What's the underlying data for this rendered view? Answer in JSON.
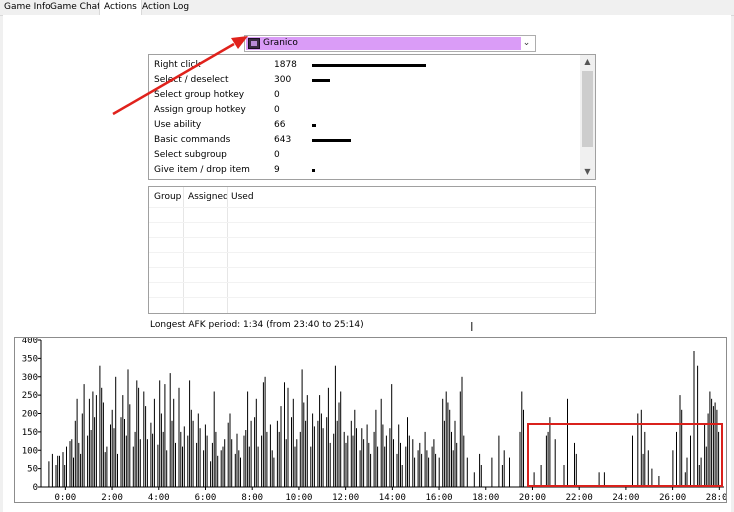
{
  "tabs": [
    {
      "label": "Game Info"
    },
    {
      "label": "Game Chat"
    },
    {
      "label": "Actions",
      "active": true
    },
    {
      "label": "Action Log"
    }
  ],
  "player_select": {
    "selected": "Granico",
    "icon": "hero-portrait-icon",
    "highlight_color": "#da9cf7"
  },
  "actions": [
    {
      "name": "Right click",
      "count": "1878",
      "fraction": 1.0
    },
    {
      "name": "Select / deselect",
      "count": "300",
      "fraction": 0.16
    },
    {
      "name": "Select group hotkey",
      "count": "0",
      "fraction": 0
    },
    {
      "name": "Assign group hotkey",
      "count": "0",
      "fraction": 0
    },
    {
      "name": "Use ability",
      "count": "66",
      "fraction": 0.035
    },
    {
      "name": "Basic commands",
      "count": "643",
      "fraction": 0.34
    },
    {
      "name": "Select subgroup",
      "count": "0",
      "fraction": 0
    },
    {
      "name": "Give item / drop item",
      "count": "9",
      "fraction": 0.005
    }
  ],
  "hotkey_table": {
    "columns": [
      "Group",
      "Assigned",
      "Used"
    ]
  },
  "afk_text": "Longest AFK period: 1:34 (from 23:40 to 25:14)",
  "annotation_colors": {
    "arrow": "#e0221c",
    "box": "#d9211c"
  },
  "chart_data": {
    "type": "bar",
    "ylim": [
      0,
      400
    ],
    "yticks": [
      "0",
      "50",
      "100",
      "150",
      "200",
      "250",
      "300",
      "350",
      "400"
    ],
    "xticks": [
      "0:00",
      "2:00",
      "4:00",
      "6:00",
      "8:00",
      "10:00",
      "12:00",
      "14:00",
      "16:00",
      "18:00",
      "20:00",
      "22:00",
      "24:00",
      "26:00",
      "28:00"
    ],
    "x_unit_minutes_per_bar": 0.1667,
    "xlim_minutes": [
      0,
      29.2
    ],
    "values": [
      0,
      70,
      0,
      90,
      0,
      60,
      85,
      85,
      0,
      95,
      60,
      110,
      0,
      125,
      130,
      80,
      180,
      240,
      120,
      90,
      200,
      280,
      0,
      140,
      240,
      155,
      260,
      190,
      250,
      0,
      330,
      270,
      230,
      95,
      110,
      0,
      170,
      210,
      160,
      300,
      90,
      0,
      190,
      250,
      185,
      140,
      320,
      225,
      0,
      110,
      150,
      290,
      270,
      130,
      0,
      260,
      220,
      130,
      0,
      175,
      145,
      240,
      0,
      115,
      290,
      200,
      150,
      280,
      100,
      0,
      310,
      180,
      240,
      120,
      0,
      270,
      150,
      110,
      165,
      0,
      140,
      290,
      210,
      180,
      0,
      120,
      200,
      160,
      0,
      100,
      170,
      140,
      0,
      70,
      120,
      260,
      150,
      85,
      0,
      100,
      110,
      130,
      0,
      175,
      200,
      130,
      0,
      90,
      145,
      100,
      80,
      0,
      140,
      155,
      260,
      110,
      180,
      0,
      190,
      240,
      110,
      0,
      140,
      285,
      300,
      150,
      0,
      170,
      100,
      80,
      0,
      180,
      150,
      220,
      0,
      285,
      130,
      270,
      0,
      190,
      240,
      110,
      130,
      0,
      150,
      320,
      230,
      180,
      250,
      0,
      110,
      200,
      165,
      0,
      180,
      250,
      200,
      160,
      0,
      190,
      270,
      120,
      0,
      145,
      330,
      180,
      230,
      260,
      0,
      150,
      120,
      140,
      0,
      180,
      140,
      210,
      160,
      0,
      100,
      160,
      130,
      0,
      170,
      120,
      90,
      0,
      150,
      210,
      110,
      0,
      240,
      170,
      110,
      140,
      0,
      160,
      280,
      130,
      0,
      90,
      170,
      120,
      60,
      0,
      110,
      190,
      140,
      0,
      130,
      80,
      0,
      100,
      120,
      90,
      0,
      150,
      100,
      80,
      0,
      110,
      130,
      90,
      0,
      80,
      0,
      240,
      180,
      260,
      230,
      210,
      150,
      100,
      180,
      120,
      0,
      260,
      300,
      140,
      0,
      80,
      0,
      0,
      0,
      40,
      0,
      0,
      90,
      60,
      0,
      0,
      0,
      0,
      0,
      80,
      0,
      0,
      0,
      140,
      0,
      60,
      100,
      0,
      0,
      80,
      0,
      0,
      0,
      0,
      0,
      150,
      260,
      210,
      0,
      0,
      0,
      0,
      0,
      40,
      0,
      0,
      0,
      60,
      0,
      0,
      140,
      150,
      190,
      0,
      0,
      130,
      0,
      0,
      0,
      0,
      60,
      0,
      240,
      0,
      0,
      0,
      120,
      90,
      0,
      0,
      0,
      0,
      0,
      0,
      0,
      0,
      0,
      0,
      0,
      0,
      40,
      0,
      0,
      40,
      0,
      0,
      0,
      0,
      0,
      0,
      0,
      0,
      0,
      0,
      0,
      0,
      0,
      0,
      0,
      140,
      0,
      0,
      200,
      0,
      210,
      90,
      150,
      0,
      100,
      0,
      50,
      0,
      0,
      0,
      30,
      0,
      0,
      0,
      0,
      0,
      0,
      0,
      100,
      0,
      150,
      0,
      250,
      210,
      0,
      40,
      80,
      0,
      140,
      0,
      370,
      0,
      330,
      60,
      80,
      0,
      170,
      110,
      200,
      260,
      240,
      220,
      230,
      210,
      150,
      0
    ]
  }
}
